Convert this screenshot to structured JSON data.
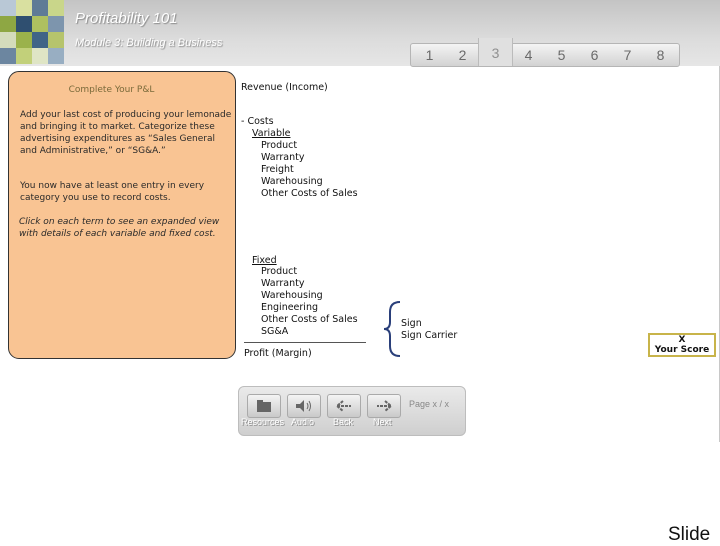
{
  "header": {
    "title": "Profitability 101",
    "subtitle": "Module 3: Building a Business"
  },
  "tabs": [
    {
      "label": "1",
      "active": false
    },
    {
      "label": "2",
      "active": false
    },
    {
      "label": "3",
      "active": true
    },
    {
      "label": "4",
      "active": false
    },
    {
      "label": "5",
      "active": false
    },
    {
      "label": "6",
      "active": false
    },
    {
      "label": "7",
      "active": false
    },
    {
      "label": "8",
      "active": false
    }
  ],
  "instructions": {
    "title": "Complete Your P&L",
    "paragraph1": "Add your last cost of producing your lemonade and bringing it to market. Categorize these advertising expenditures as “Sales General and Administrative,” or “SG&A.”",
    "paragraph2": "You now have at least one entry in every category you use to record costs.",
    "paragraph3": "Click on each term to see an expanded view with details of each variable and fixed cost."
  },
  "pl": {
    "revenue": "Revenue (Income)",
    "costs": "- Costs",
    "variable": {
      "label": "Variable",
      "items": [
        "Product",
        "Warranty",
        "Freight",
        "Warehousing",
        "Other Costs of Sales"
      ]
    },
    "fixed": {
      "label": "Fixed",
      "items": [
        "Product",
        "Warranty",
        "Warehousing",
        "Engineering",
        "Other Costs of Sales",
        "SG&A"
      ]
    },
    "profit": "Profit (Margin)"
  },
  "sga_detail": [
    "Sign",
    "Sign Carrier"
  ],
  "score": {
    "value": "X",
    "label": "Your Score"
  },
  "nav": {
    "resources": "Resources",
    "audio": "Audio",
    "back": "Back",
    "next": "Next",
    "page": "Page x / x"
  },
  "footer": {
    "slide": "Slide"
  },
  "colors": {
    "callout": "#f9c493",
    "score_border": "#c8b44a"
  }
}
